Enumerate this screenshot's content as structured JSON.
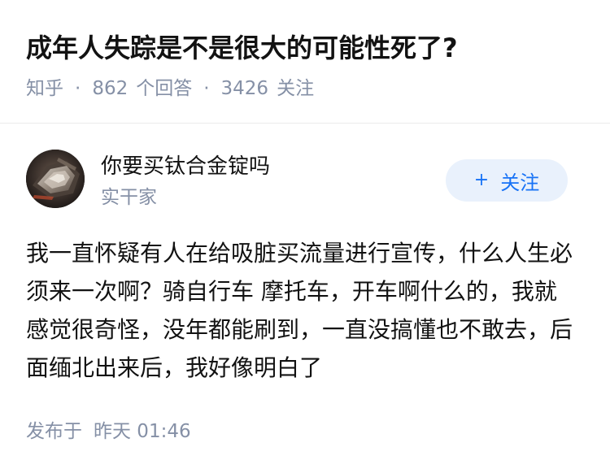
{
  "question": {
    "title": "成年人失踪是不是很大的可能性死了?",
    "source": "知乎",
    "separator": "·",
    "answer_count": "862",
    "answer_label": "个回答",
    "follower_count": "3426",
    "follower_label": "关注"
  },
  "author": {
    "name": "你要买钛合金锭吗",
    "tag": "实干家",
    "avatar_icon": "avatar-photo-icon",
    "follow_icon": "plus-icon",
    "follow_plus": "+",
    "follow_label": "关注"
  },
  "answer": {
    "text": "我一直怀疑有人在给吸脏买流量进行宣传，什么人生必须来一次啊？骑自行车 摩托车，开车啊什么的，我就感觉很奇怪，没年都能刷到，一直没搞懂也不敢去，后面缅北出来后，我好像明白了",
    "time_prefix": "发布于",
    "time_value": "昨天 01:46"
  },
  "colors": {
    "text": "#121212",
    "meta": "#8590a6",
    "accent": "#1772f6",
    "follow_bg": "#e9f1fc",
    "divider": "#ebebeb"
  }
}
